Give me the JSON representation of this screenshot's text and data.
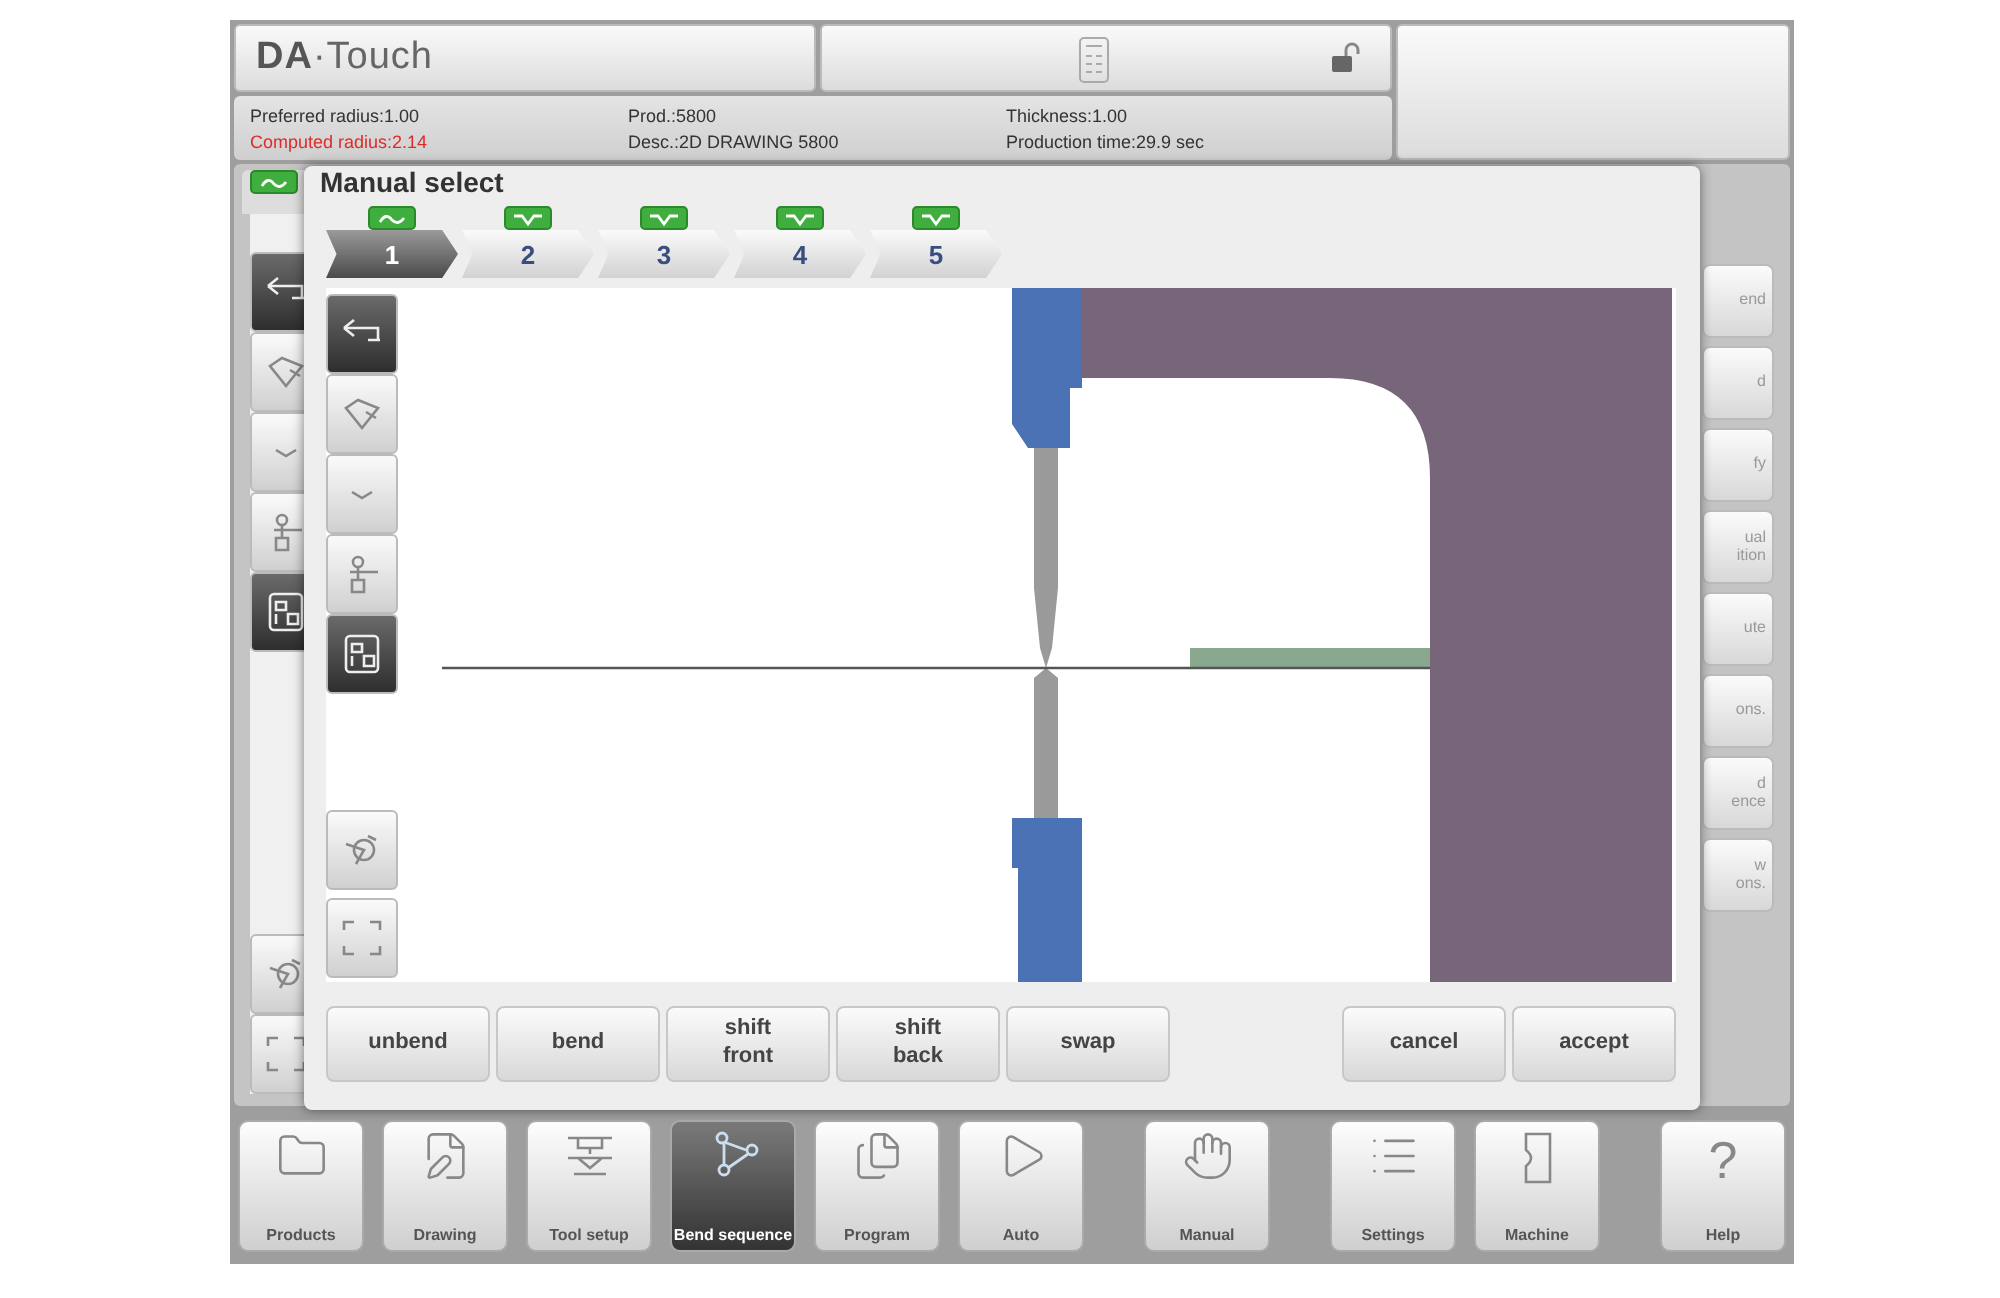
{
  "header": {
    "logo": "**DA**·Touch"
  },
  "info_columns": [
    [
      {
        "text": "Preferred radius:1.00",
        "warning": false
      },
      {
        "text": "Computed radius:2.14",
        "warning": true
      }
    ],
    [
      {
        "text": "Prod.:5800",
        "warning": false
      },
      {
        "text": "Desc.:2D DRAWING 5800",
        "warning": false
      }
    ],
    [
      {
        "text": "Thickness:1.00",
        "warning": false
      },
      {
        "text": "Production time:29.9 sec",
        "warning": false
      }
    ]
  ],
  "background_side_buttons": [
    {
      "lines": [
        "end"
      ]
    },
    {
      "lines": [
        "d"
      ]
    },
    {
      "lines": [
        "fy"
      ]
    },
    {
      "lines": [
        "ual",
        "ition"
      ]
    },
    {
      "lines": [
        "ute"
      ]
    },
    {
      "lines": [
        "ons."
      ]
    },
    {
      "lines": [
        "d",
        "ence"
      ]
    },
    {
      "lines": [
        "w",
        "ons."
      ]
    }
  ],
  "background_tools": [
    {
      "kind": "profile",
      "selected": true
    },
    {
      "kind": "shape",
      "selected": false
    },
    {
      "kind": "die",
      "selected": false
    },
    {
      "kind": "operator",
      "selected": false
    },
    {
      "kind": "solid",
      "selected": true
    }
  ],
  "background_zoom_tools": [
    {
      "kind": "rotate",
      "selected": false
    },
    {
      "kind": "frame",
      "selected": false
    }
  ],
  "dialog": {
    "title": "Manual select",
    "tabs": [
      {
        "number": "1",
        "kind": "curve",
        "selected": true
      },
      {
        "number": "2",
        "kind": "vee",
        "selected": false
      },
      {
        "number": "3",
        "kind": "vee",
        "selected": false
      },
      {
        "number": "4",
        "kind": "vee",
        "selected": false
      },
      {
        "number": "5",
        "kind": "vee",
        "selected": false
      }
    ],
    "view_tools": [
      {
        "kind": "profile",
        "selected": true
      },
      {
        "kind": "shape",
        "selected": false
      },
      {
        "kind": "die",
        "selected": false
      },
      {
        "kind": "operator",
        "selected": false
      },
      {
        "kind": "solid",
        "selected": true
      }
    ],
    "zoom_tools": [
      {
        "kind": "rotate",
        "selected": false
      },
      {
        "kind": "frame",
        "selected": false
      }
    ],
    "left_buttons": [
      {
        "lines": [
          "unbend"
        ]
      },
      {
        "lines": [
          "bend"
        ]
      },
      {
        "lines": [
          "shift",
          "front"
        ]
      },
      {
        "lines": [
          "shift",
          "back"
        ]
      },
      {
        "lines": [
          "swap"
        ]
      }
    ],
    "right_buttons": [
      {
        "lines": [
          "cancel"
        ]
      },
      {
        "lines": [
          "accept"
        ]
      }
    ]
  },
  "nav_groups": [
    [
      {
        "label": "Products",
        "kind": "folder",
        "selected": false
      },
      {
        "label": "Drawing",
        "kind": "drawing",
        "selected": false
      },
      {
        "label": "Tool setup",
        "kind": "tools",
        "selected": false
      },
      {
        "label": "Bend sequence",
        "kind": "bend",
        "selected": true
      },
      {
        "label": "Program",
        "kind": "program",
        "selected": false
      },
      {
        "label": "Auto",
        "kind": "play",
        "selected": false
      }
    ],
    [
      {
        "label": "Manual",
        "kind": "hand",
        "selected": false
      }
    ],
    [
      {
        "label": "Settings",
        "kind": "list",
        "selected": false
      },
      {
        "label": "Machine",
        "kind": "machine",
        "selected": false
      }
    ],
    [
      {
        "label": "Help",
        "kind": "help",
        "glyph": "?",
        "selected": false
      }
    ]
  ]
}
